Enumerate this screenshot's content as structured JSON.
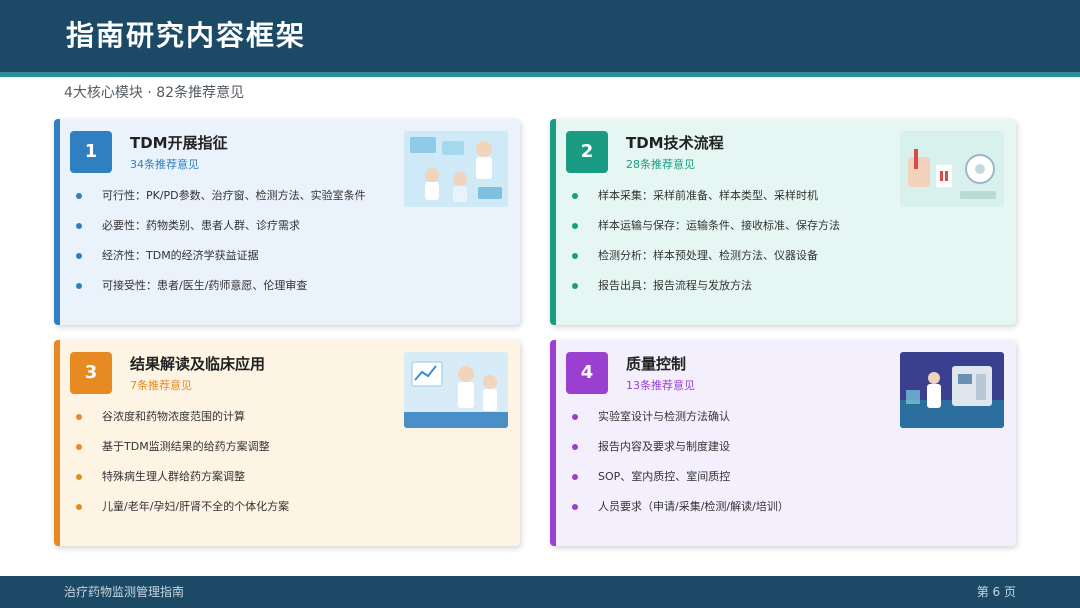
{
  "header": {
    "title": "指南研究内容框架"
  },
  "subtitle": "4大核心模块 · 82条推荐意见",
  "cards": [
    {
      "number": "1",
      "title": "TDM开展指征",
      "count": "34条推荐意见",
      "accent": "#2f7fc1",
      "bg": "#eaf2fc",
      "items": [
        "可行性：PK/PD参数、治疗窗、检测方法、实验室条件",
        "必要性：药物类别、患者人群、诊疗需求",
        "经济性：TDM的经济学获益证据",
        "可接受性：患者/医生/药师意愿、伦理审查"
      ]
    },
    {
      "number": "2",
      "title": "TDM技术流程",
      "count": "28条推荐意见",
      "accent": "#1a9c82",
      "bg": "#e6f7f3",
      "items": [
        "样本采集：采样前准备、样本类型、采样时机",
        "样本运输与保存：运输条件、接收标准、保存方法",
        "检测分析：样本预处理、检测方法、仪器设备",
        "报告出具：报告流程与发放方法"
      ]
    },
    {
      "number": "3",
      "title": "结果解读及临床应用",
      "count": "7条推荐意见",
      "accent": "#e88a22",
      "bg": "#fdf4e4",
      "items": [
        "谷浓度和药物浓度范围的计算",
        "基于TDM监测结果的给药方案调整",
        "特殊病生理人群给药方案调整",
        "儿童/老年/孕妇/肝肾不全的个体化方案"
      ]
    },
    {
      "number": "4",
      "title": "质量控制",
      "count": "13条推荐意见",
      "accent": "#9a3fd0",
      "bg": "#f4effc",
      "items": [
        "实验室设计与检测方法确认",
        "报告内容及要求与制度建设",
        "SOP、室内质控、室间质控",
        "人员要求（申请/采集/检测/解读/培训）"
      ]
    }
  ],
  "footer": {
    "left": "治疗药物监测管理指南",
    "right": "第 6 页"
  }
}
